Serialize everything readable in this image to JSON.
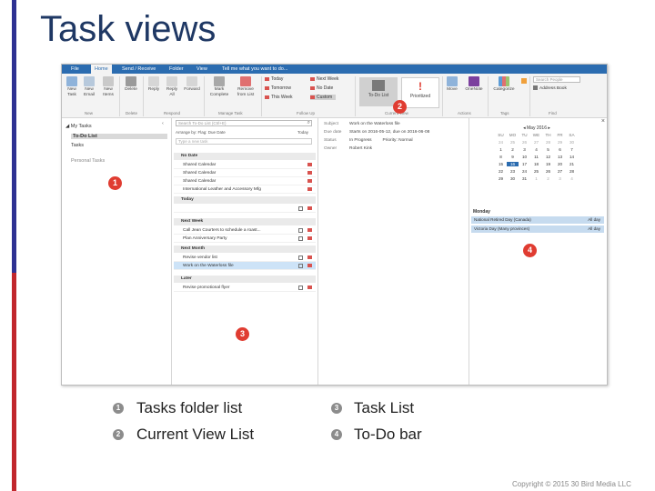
{
  "slide": {
    "title": "Task views",
    "copyright": "Copyright © 2015 30 Bird Media LLC"
  },
  "legend": [
    {
      "num": "1",
      "label": "Tasks folder list"
    },
    {
      "num": "2",
      "label": "Current View List"
    },
    {
      "num": "3",
      "label": "Task List"
    },
    {
      "num": "4",
      "label": "To-Do bar"
    }
  ],
  "callouts": [
    "1",
    "2",
    "3",
    "4"
  ],
  "outlook": {
    "menu": [
      "File",
      "Home",
      "Send / Receive",
      "Folder",
      "View",
      "Tell me what you want to do..."
    ],
    "ribbon": {
      "buttons": [
        "New Task",
        "New Email",
        "New Items",
        "Delete",
        "Reply",
        "Reply All",
        "Forward",
        "Mark Complete",
        "Remove from List",
        "Move",
        "OneNote",
        "Categorize"
      ],
      "followup": [
        "Today",
        "Tomorrow",
        "This Week",
        "Next Week",
        "No Date",
        "Custom"
      ],
      "views": [
        "To-Do List",
        "Prioritized"
      ],
      "groups": [
        "New",
        "Delete",
        "Respond",
        "Manage Task",
        "Follow Up",
        "Current View",
        "Actions",
        "Tags",
        "Find"
      ],
      "search_people": "Search People",
      "address_book": "Address Book"
    },
    "nav": {
      "header": "My Tasks",
      "items": [
        "To-Do List",
        "Tasks"
      ],
      "other": "Personal Tasks"
    },
    "tasks": {
      "search_placeholder": "Search To-Do List (Ctrl+E)",
      "arrange": "Arrange by: Flag: Due Date",
      "arrange_right": "Today",
      "new_task": "Type a new task",
      "groups": [
        {
          "name": "No Date",
          "items": [
            "Shared Calendar",
            "Shared Calendar",
            "Shared Calendar",
            "International Leather and Accessory Mfg"
          ]
        },
        {
          "name": "Today",
          "items": []
        },
        {
          "name": "Next Week",
          "items": [
            "Call Jean Courters to schedule a roast...",
            "Plan Anniversary Party"
          ]
        },
        {
          "name": "Next Month",
          "items": [
            "Revise vendor list",
            "Work on the Waterloss file"
          ]
        },
        {
          "name": "Later",
          "items": [
            "Revise promotional flyer"
          ]
        }
      ]
    },
    "reading": {
      "subject_label": "Subject",
      "subject": "Work on the Waterloss file",
      "due_label": "Due date",
      "due": "Starts on 2016-05-12, due on 2016-06-08",
      "status_label": "Status",
      "status": "In Progress",
      "priority": "Priority: Normal",
      "owner_label": "Owner",
      "owner": "Robert Kink"
    },
    "todobar": {
      "month": "May 2016",
      "days": [
        "SU",
        "MO",
        "TU",
        "WE",
        "TH",
        "FR",
        "SA"
      ],
      "weeks": [
        [
          "24",
          "25",
          "26",
          "27",
          "28",
          "29",
          "30"
        ],
        [
          "1",
          "2",
          "3",
          "4",
          "5",
          "6",
          "7"
        ],
        [
          "8",
          "9",
          "10",
          "11",
          "12",
          "13",
          "14"
        ],
        [
          "15",
          "16",
          "17",
          "18",
          "19",
          "20",
          "21"
        ],
        [
          "22",
          "23",
          "24",
          "25",
          "26",
          "27",
          "28"
        ],
        [
          "29",
          "30",
          "31",
          "1",
          "2",
          "3",
          "4"
        ]
      ],
      "today": "16",
      "day_label": "Monday",
      "events": [
        {
          "name": "National Retired Day (Canada)",
          "when": "All day"
        },
        {
          "name": "Victoria Day (Many provinces)",
          "when": "All day"
        }
      ]
    }
  },
  "colors": {
    "title": "#1f3864",
    "accent_blue": "#2b6cb0",
    "callout_red": "#e03c31",
    "stripe_navy": "#2e3192",
    "stripe_red": "#c1272d"
  }
}
